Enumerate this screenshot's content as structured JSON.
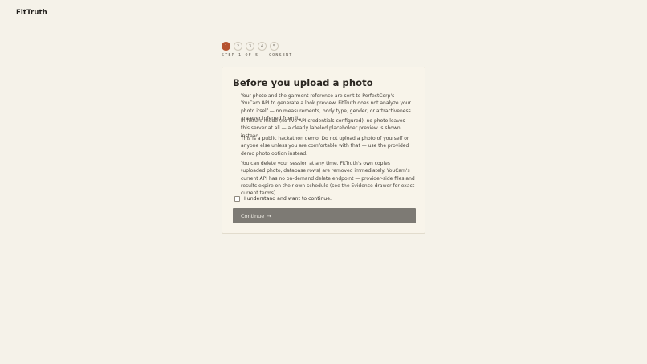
{
  "brand": {
    "logo_text": "FitTruth"
  },
  "stepper": {
    "steps": [
      "1",
      "2",
      "3",
      "4",
      "5"
    ],
    "current": 1,
    "status_text": "STEP 1 OF 5 — CONSENT"
  },
  "card": {
    "title": "Before you upload a photo",
    "paragraphs": [
      "Your photo and the garment reference are sent to PerfectCorp's YouCam API to generate a look preview. FitTruth does not analyze your photo itself — no measurements, body type, gender, or attractiveness are ever inferred from it.",
      "In fixture mode (no live API credentials configured), no photo leaves this server at all — a clearly labeled placeholder preview is shown instead.",
      "This is a public hackathon demo. Do not upload a photo of yourself or anyone else unless you are comfortable with that — use the provided demo photo option instead.",
      "You can delete your session at any time. FitTruth's own copies (uploaded photo, database rows) are removed immediately. YouCam's current API has no on-demand delete endpoint — provider-side files and results expire on their own schedule (see the Evidence drawer for exact current terms)."
    ],
    "consent_label": "I understand and want to continue.",
    "consent_checked": false,
    "continue_label": "Continue",
    "continue_arrow": "→"
  },
  "colors": {
    "background": "#f5f2e9",
    "accent": "#b6532f",
    "button_disabled": "#7d7a74"
  }
}
